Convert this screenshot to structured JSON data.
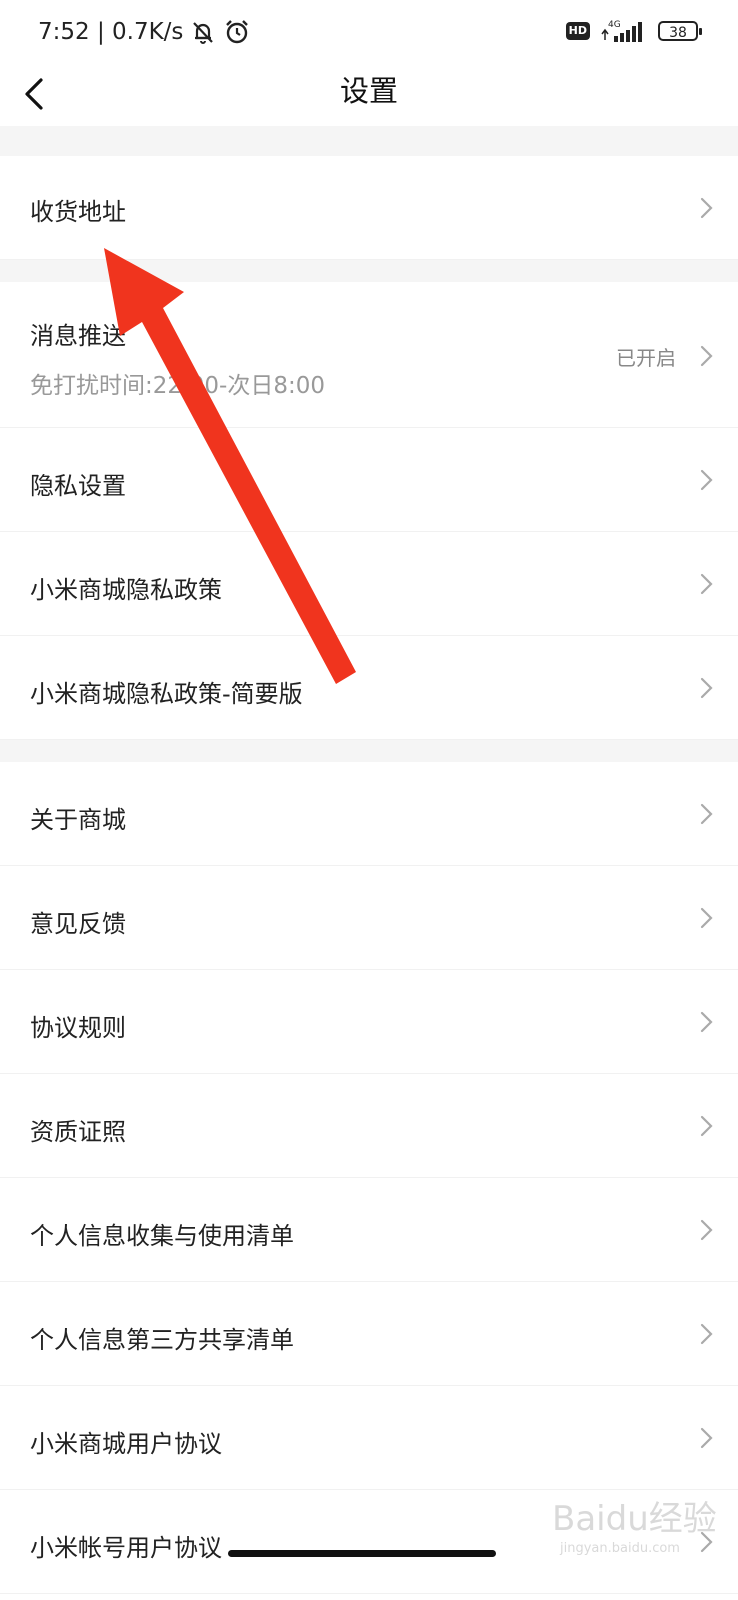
{
  "status_bar": {
    "time_speed": "7:52 | 0.7K/s",
    "hd": "HD",
    "network": "4G",
    "battery": "38"
  },
  "header": {
    "title": "设置"
  },
  "rows": {
    "address": "收货地址",
    "push_label": "消息推送",
    "push_sub": "免打扰时间:22:00-次日8:00",
    "push_value": "已开启",
    "privacy_settings": "隐私设置",
    "privacy_policy": "小米商城隐私政策",
    "privacy_policy_brief": "小米商城隐私政策-简要版",
    "about": "关于商城",
    "feedback": "意见反馈",
    "rules": "协议规则",
    "qualification": "资质证照",
    "personal_info_list": "个人信息收集与使用清单",
    "third_party_list": "个人信息第三方共享清单",
    "user_agreement": "小米商城用户协议",
    "account_agreement": "小米帐号用户协议"
  },
  "watermark": {
    "brand": "Baidu经验",
    "url": "jingyan.baidu.com"
  },
  "colors": {
    "arrow": "#f0341e",
    "section_gap": "#f5f5f5"
  }
}
